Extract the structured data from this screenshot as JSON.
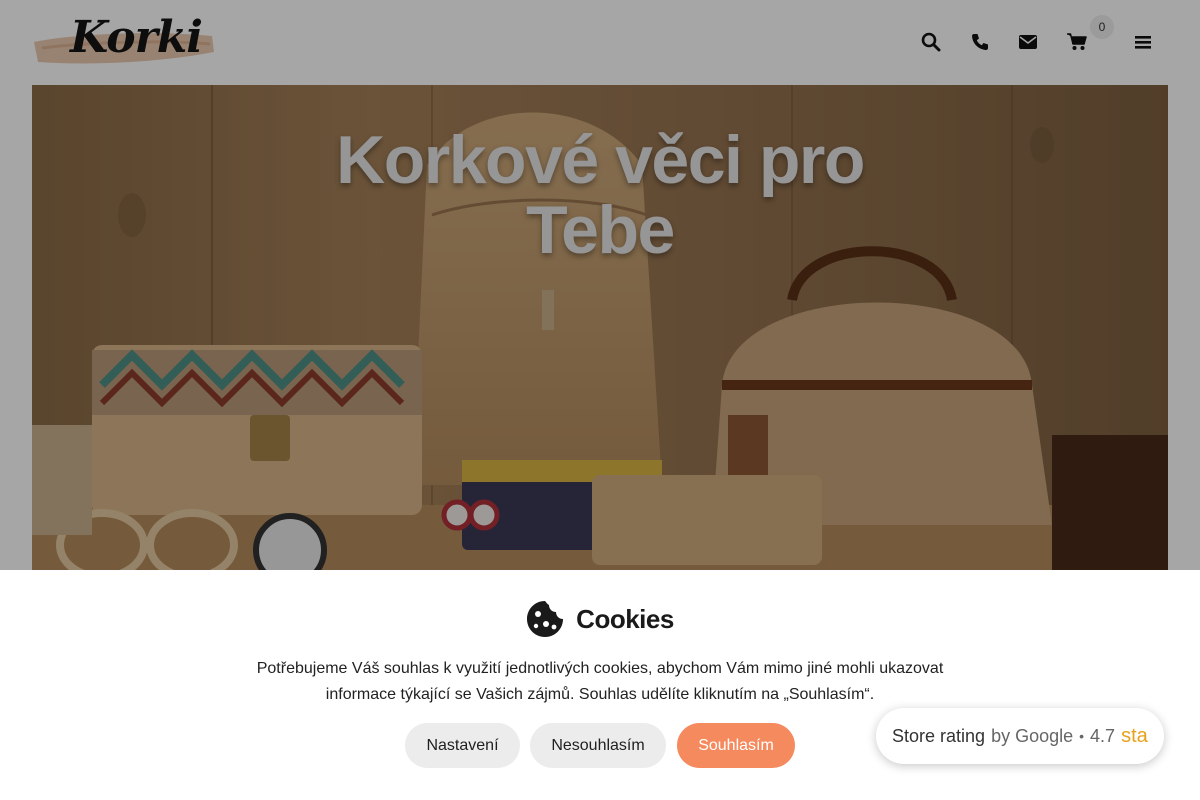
{
  "header": {
    "logo_text": "Korki",
    "cart_count": "0"
  },
  "icons": {
    "search": "search-icon",
    "phone": "phone-icon",
    "mail": "envelope-icon",
    "cart": "cart-icon",
    "menu": "hamburger-menu-icon",
    "cookie": "cookie-icon"
  },
  "hero": {
    "title_line1": "Korkové věci pro",
    "title_line2": "Tebe"
  },
  "cookies": {
    "title": "Cookies",
    "text_line1": "Potřebujeme Váš souhlas k využití jednotlivých cookies, abychom Vám mimo jiné mohli ukazovat",
    "text_line2": "informace týkající se Vašich zájmů. Souhlas udělíte kliknutím na „Souhlasím“.",
    "settings_label": "Nastavení",
    "decline_label": "Nesouhlasím",
    "accept_label": "Souhlasím"
  },
  "rating": {
    "store_label": "Store rating",
    "by_label": "by Google",
    "separator": "•",
    "value": "4.7",
    "stars_text": "sta"
  },
  "colors": {
    "accent": "#f58a5e",
    "button_grey": "#ececec",
    "star": "#e8a21a"
  }
}
